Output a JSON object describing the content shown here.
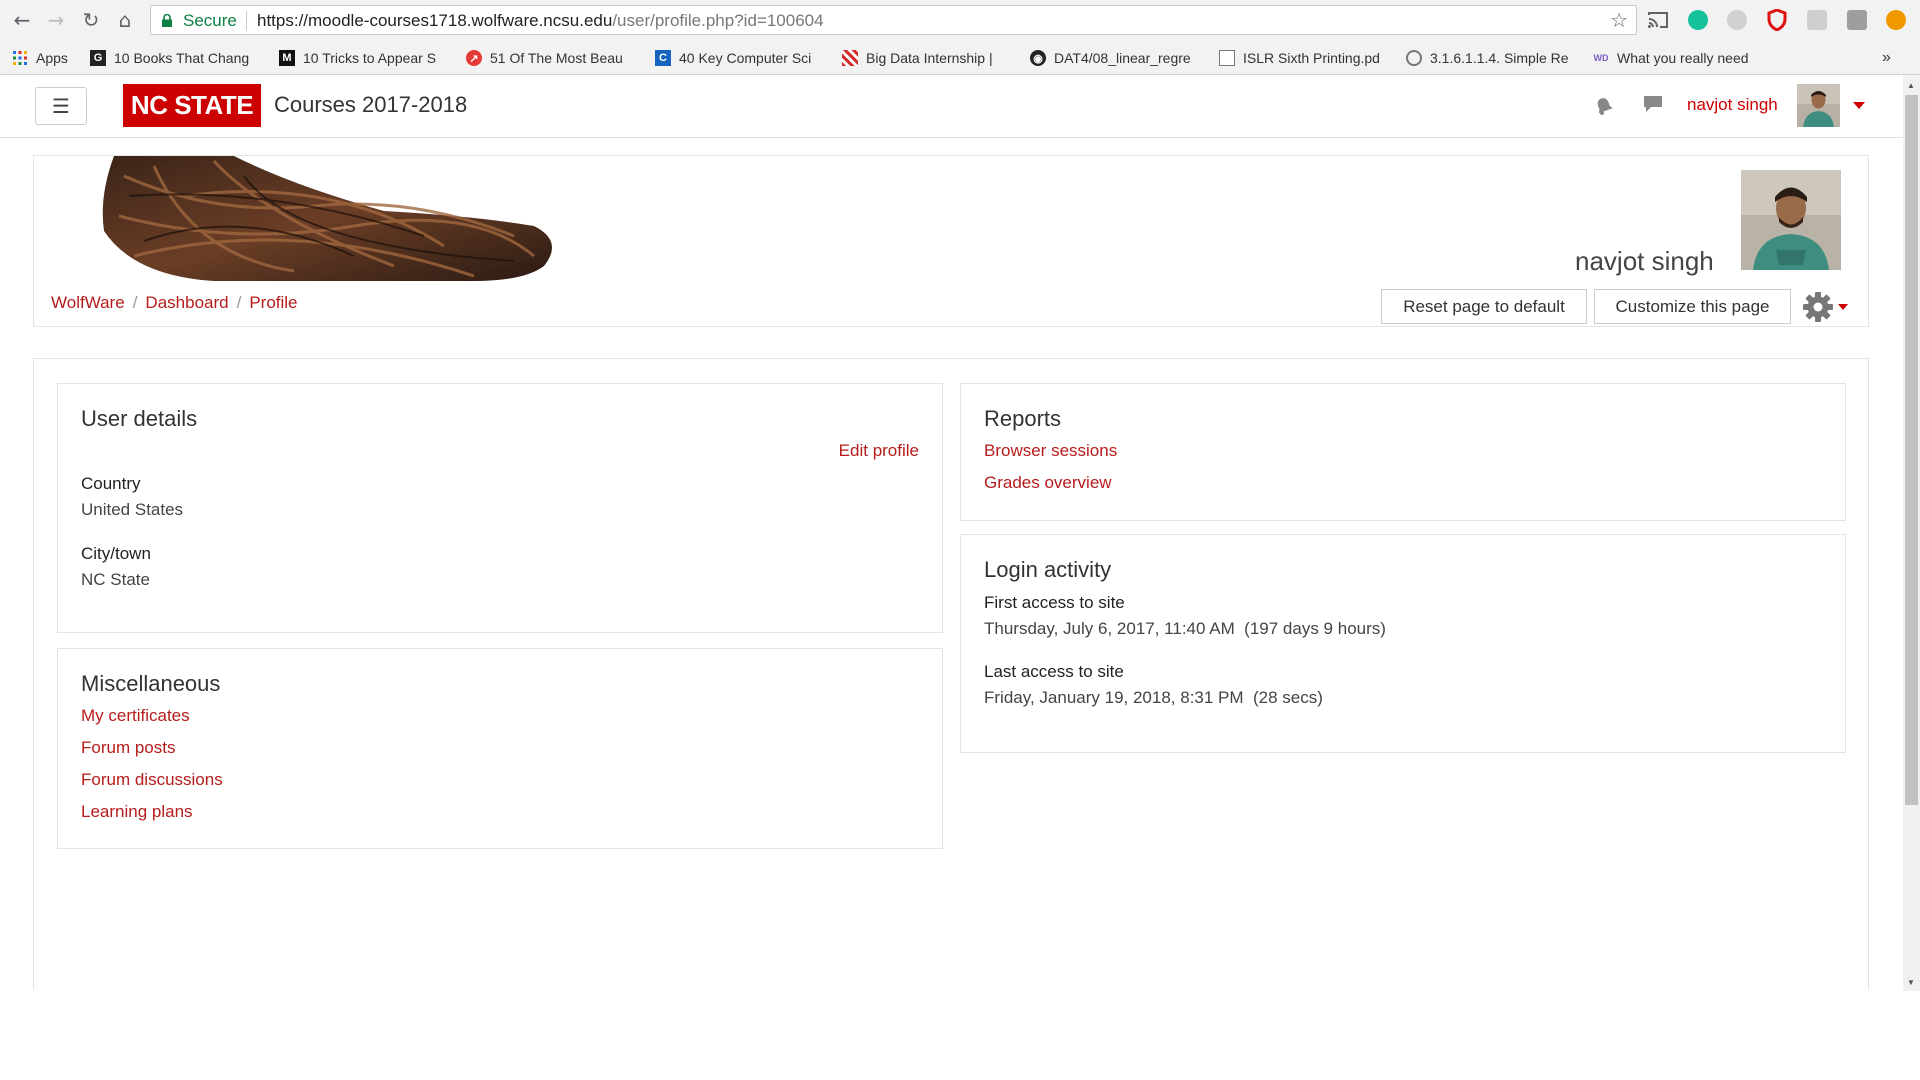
{
  "browser": {
    "secure_label": "Secure",
    "url_main": "https://moodle-courses1718.wolfware.ncsu.edu",
    "url_path": "/user/profile.php?id=100604",
    "bookmarks": [
      {
        "label": "Apps"
      },
      {
        "label": "10 Books That Chang"
      },
      {
        "label": "10 Tricks to Appear S"
      },
      {
        "label": "51 Of The Most Beau"
      },
      {
        "label": "40 Key Computer Sci"
      },
      {
        "label": "Big Data Internship |"
      },
      {
        "label": "DAT4/08_linear_regre"
      },
      {
        "label": "ISLR Sixth Printing.pd"
      },
      {
        "label": "3.1.6.1.1.4. Simple Re"
      },
      {
        "label": "What you really need"
      }
    ],
    "more_bookmarks": "»"
  },
  "navbar": {
    "brand": "NC STATE",
    "site_name": "Courses 2017-2018",
    "user_name": "navjot singh",
    "accent_color": "#cc0000"
  },
  "header": {
    "profile_name": "navjot singh",
    "breadcrumb": [
      "WolfWare",
      "Dashboard",
      "Profile"
    ],
    "breadcrumb_sep": "/",
    "reset_button": "Reset page to default",
    "customize_button": "Customize this page"
  },
  "user_details": {
    "title": "User details",
    "edit_link": "Edit profile",
    "country_label": "Country",
    "country_value": "United States",
    "city_label": "City/town",
    "city_value": "NC State"
  },
  "miscellaneous": {
    "title": "Miscellaneous",
    "links": [
      "My certificates",
      "Forum posts",
      "Forum discussions",
      "Learning plans"
    ]
  },
  "reports": {
    "title": "Reports",
    "links": [
      "Browser sessions",
      "Grades overview"
    ]
  },
  "login_activity": {
    "title": "Login activity",
    "first_label": "First access to site",
    "first_value": "Thursday, July 6, 2017, 11:40 AM  (197 days 9 hours)",
    "last_label": "Last access to site",
    "last_value": "Friday, January 19, 2018, 8:31 PM  (28 secs)"
  }
}
